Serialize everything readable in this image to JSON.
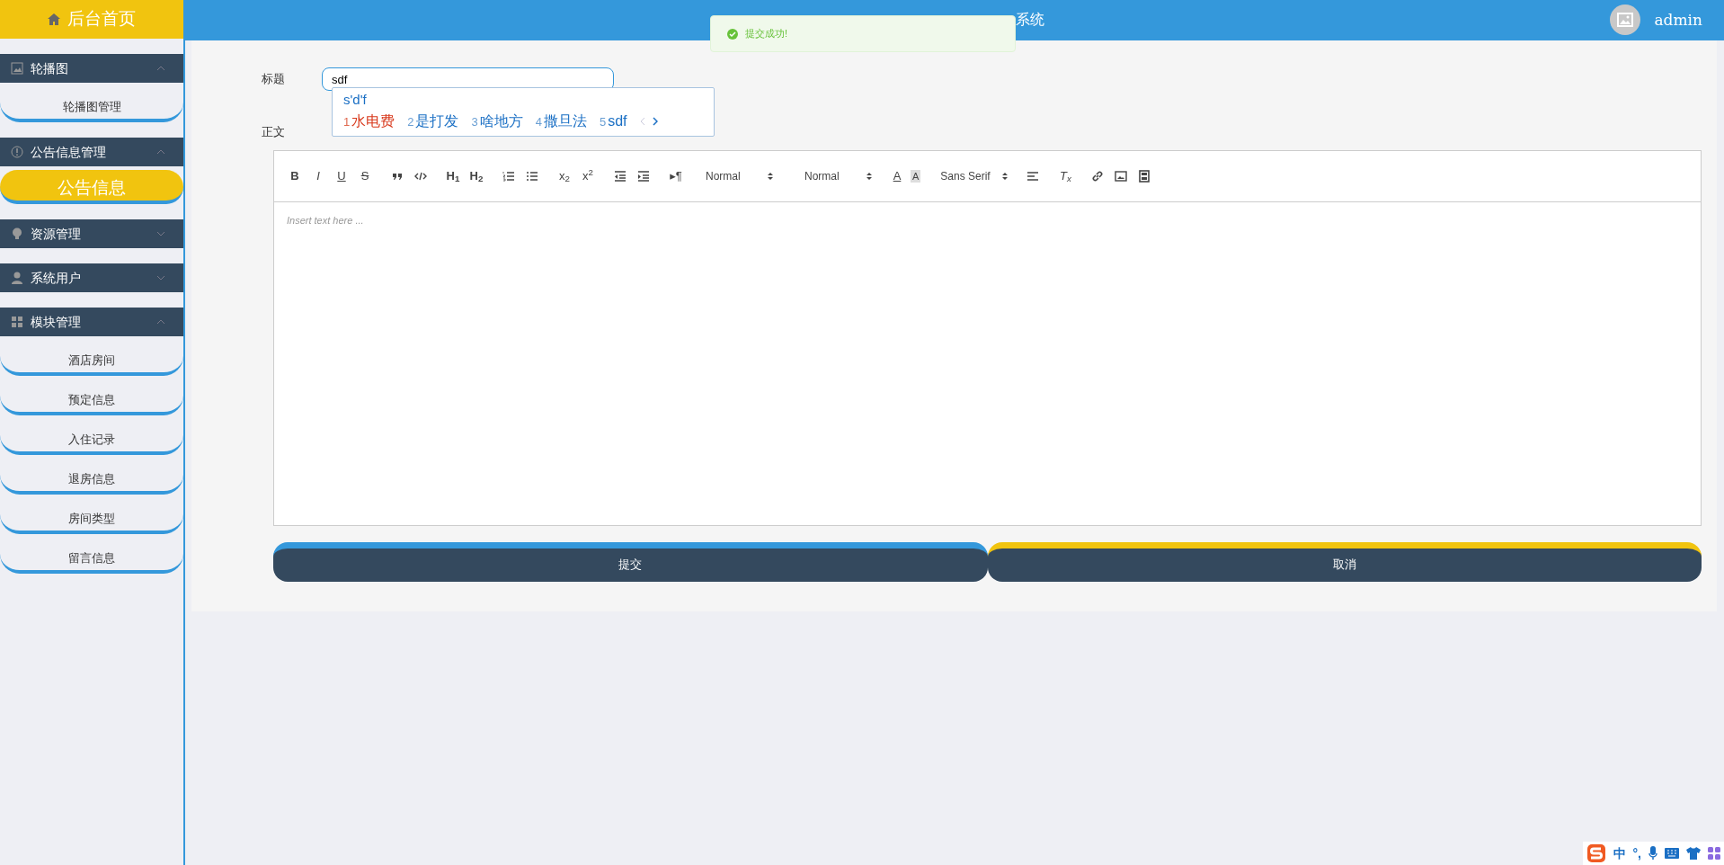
{
  "sidebar": {
    "home": "后台首页",
    "sections": [
      {
        "label": "轮播图",
        "expanded": true,
        "items": [
          {
            "label": "轮播图管理",
            "selected": false
          }
        ]
      },
      {
        "label": "公告信息管理",
        "expanded": true,
        "items": [
          {
            "label": "公告信息",
            "selected": true
          }
        ]
      },
      {
        "label": "资源管理",
        "expanded": false
      },
      {
        "label": "系统用户",
        "expanded": false
      },
      {
        "label": "模块管理",
        "expanded": true,
        "items": [
          {
            "label": "酒店房间",
            "selected": false
          },
          {
            "label": "预定信息",
            "selected": false
          },
          {
            "label": "入住记录",
            "selected": false
          },
          {
            "label": "退房信息",
            "selected": false
          },
          {
            "label": "房间类型",
            "selected": false
          },
          {
            "label": "留言信息",
            "selected": false
          }
        ]
      }
    ]
  },
  "header": {
    "title": "系统",
    "user": "admin"
  },
  "toast": {
    "message": "提交成功!"
  },
  "form": {
    "title_label": "标题",
    "title_value": "sdf",
    "body_label": "正文",
    "body_placeholder": "Insert text here ...",
    "toolbar": [
      [
        {
          "kind": "bold",
          "label": "B"
        },
        {
          "kind": "italic",
          "label": "I"
        },
        {
          "kind": "underline",
          "label": "U"
        },
        {
          "kind": "strike",
          "label": "S"
        }
      ],
      [
        {
          "kind": "icon"
        },
        {
          "kind": "icon"
        }
      ],
      [
        {
          "kind": "heading",
          "label": "H$_{1}$"
        },
        {
          "kind": "heading",
          "label": "H$_{2}$"
        }
      ],
      [
        {
          "kind": "icon"
        },
        {
          "kind": "icon"
        }
      ],
      [
        {
          "kind": "script",
          "label": "x$_{2}$"
        },
        {
          "kind": "script",
          "label": "x$^{2}$"
        }
      ],
      [
        {
          "kind": "icon"
        },
        {
          "kind": "icon"
        }
      ],
      [
        {
          "kind": "plain",
          "label": "▸¶"
        }
      ],
      [
        {
          "kind": "select",
          "value": "Normal"
        },
        {
          "kind": "select",
          "value": "Normal"
        }
      ],
      [
        {
          "kind": "color",
          "label": "A"
        },
        {
          "kind": "background",
          "label": "A"
        }
      ],
      [
        {
          "kind": "select",
          "value": "Sans Serif"
        }
      ],
      [
        {
          "kind": "icon"
        }
      ],
      [
        {
          "kind": "clean",
          "label": "T$_{x}$"
        }
      ],
      [
        {
          "kind": "icon"
        },
        {
          "kind": "icon"
        },
        {
          "kind": "icon"
        }
      ]
    ],
    "buttons": [
      {
        "label": "提交",
        "kind": "submit"
      },
      {
        "label": "取消",
        "kind": "cancel"
      }
    ]
  },
  "ime": {
    "composition": "s'd'f",
    "candidates": [
      {
        "number": "1",
        "text": "水电费",
        "selected": true
      },
      {
        "number": "2",
        "text": "是打发",
        "selected": false
      },
      {
        "number": "3",
        "text": "啥地方",
        "selected": false
      },
      {
        "number": "4",
        "text": "撒旦法",
        "selected": false
      },
      {
        "number": "5",
        "text": "sdf",
        "selected": false
      }
    ],
    "tray": {
      "mode": "中",
      "punct": "°,"
    }
  }
}
